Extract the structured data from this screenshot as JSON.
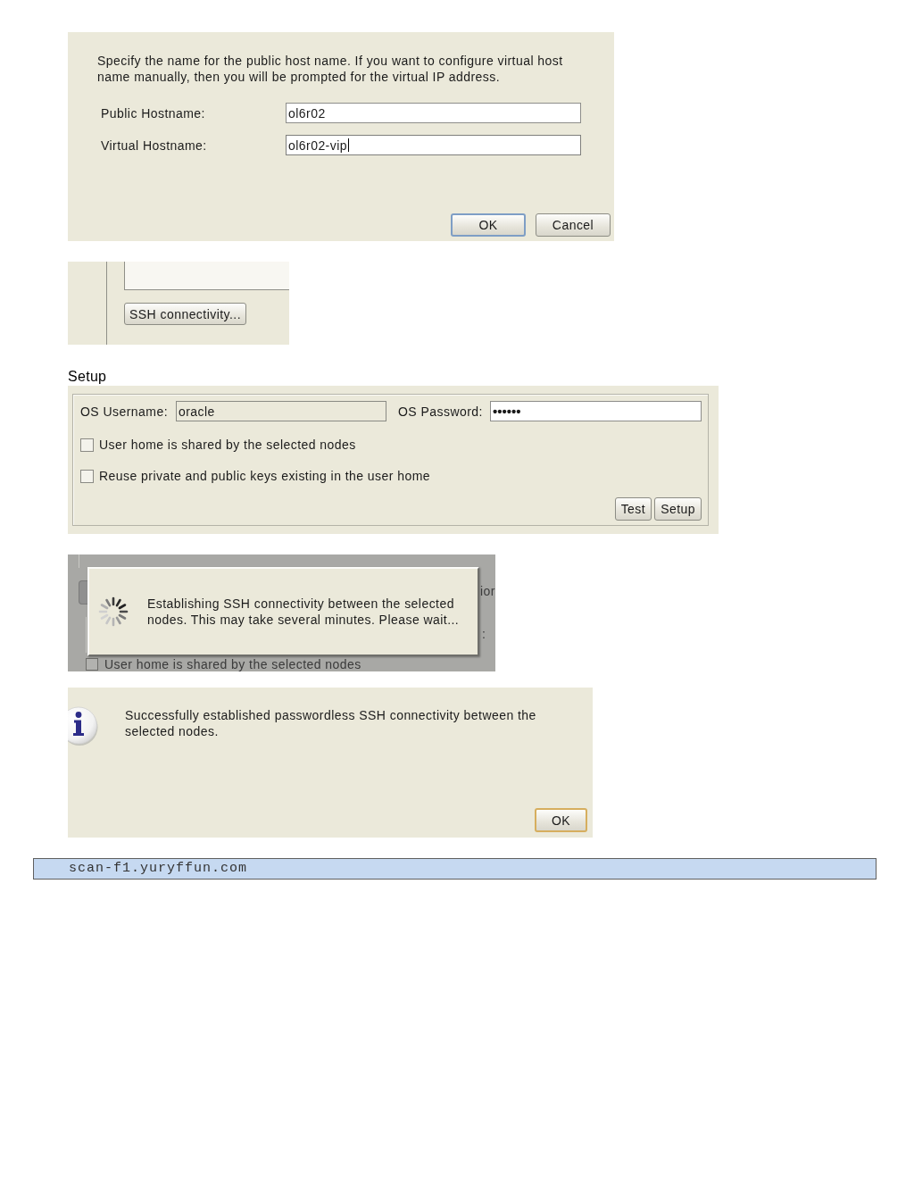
{
  "host_dialog": {
    "message": "Specify the name for the public host name. If you want to configure virtual host name manually, then you will be prompted for the virtual IP address.",
    "fields": [
      {
        "label": "Public Hostname:",
        "value": "ol6r02",
        "focused": false
      },
      {
        "label": "Virtual Hostname:",
        "value": "ol6r02-vip",
        "focused": true
      }
    ],
    "buttons": [
      {
        "label": "OK",
        "default": true
      },
      {
        "label": "Cancel",
        "default": false
      }
    ]
  },
  "ssh_panel": {
    "button": {
      "label": "SSH connectivity..."
    }
  },
  "setup_heading": "Setup",
  "setup_panel": {
    "fields": [
      {
        "kind": "text",
        "label": "OS Username:",
        "value": "oracle",
        "disabled": true
      },
      {
        "kind": "password",
        "label": "OS Password:",
        "value": "••••••",
        "disabled": false
      }
    ],
    "options": [
      {
        "label": "User home is shared by the selected nodes",
        "checked": false
      },
      {
        "label": "Reuse private and public keys existing in the user home",
        "checked": false
      }
    ],
    "buttons": [
      {
        "label": "Test"
      },
      {
        "label": "Setup"
      }
    ]
  },
  "progress_dialog": {
    "message": "Establishing SSH connectivity between the selected nodes. This may take several minutes. Please wait...",
    "background": {
      "button_fragment": "ior",
      "label_fragment": ":",
      "option": {
        "label": "User home is shared by the selected nodes",
        "checked": false
      }
    }
  },
  "info_dialog": {
    "message": "Successfully established passwordless SSH connectivity between the selected nodes.",
    "buttons": [
      {
        "label": "OK",
        "focused": true
      }
    ]
  },
  "hostname_bar": "scan-f1.yuryffun.com"
}
